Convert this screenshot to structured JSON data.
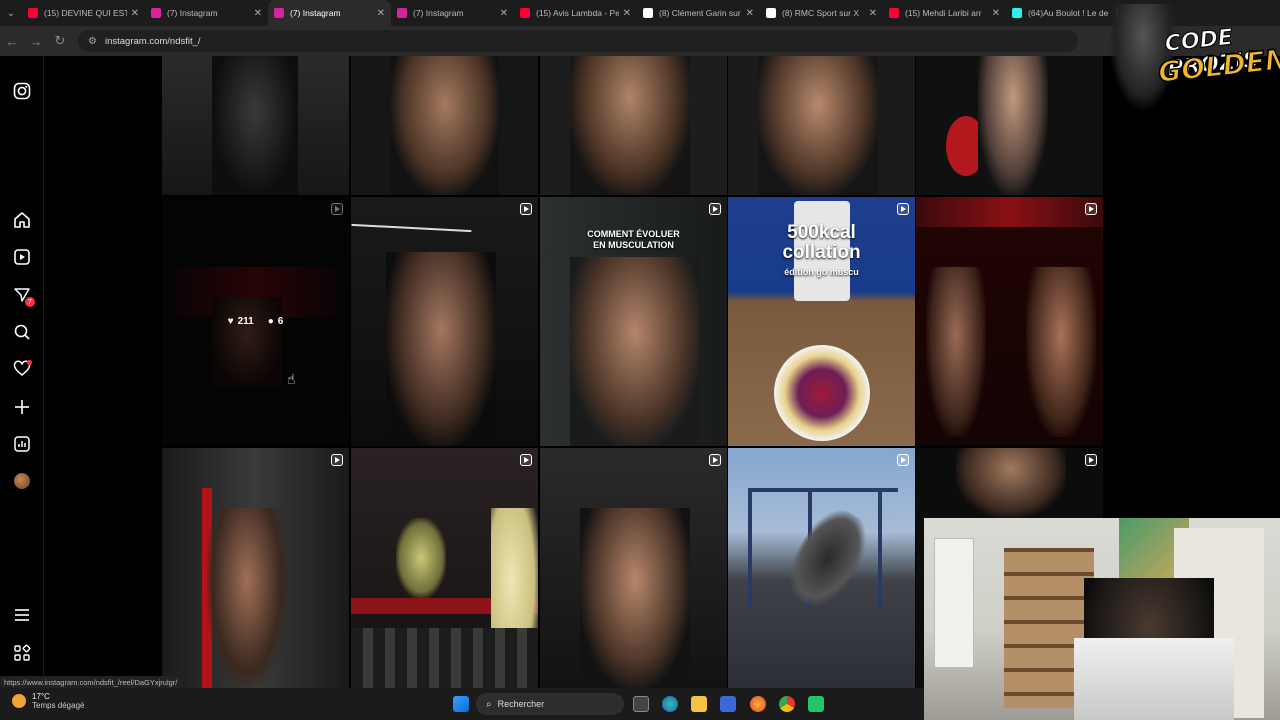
{
  "tabs": [
    {
      "title": "(15) DEVINE QUI EST",
      "icon": "youtube-icon",
      "color": "#ff0033",
      "active": false
    },
    {
      "title": "(7) Instagram",
      "icon": "instagram-icon",
      "color": "#d6249f",
      "active": false
    },
    {
      "title": "(7) Instagram",
      "icon": "instagram-icon",
      "color": "#d6249f",
      "active": true
    },
    {
      "title": "(7) Instagram",
      "icon": "instagram-icon",
      "color": "#d6249f",
      "active": false
    },
    {
      "title": "(15) Avis Lambda - Pe",
      "icon": "youtube-icon",
      "color": "#ff0033",
      "active": false
    },
    {
      "title": "(8) Clément Garin sur",
      "icon": "x-icon",
      "color": "#ffffff",
      "active": false
    },
    {
      "title": "(8) RMC Sport sur X",
      "icon": "x-icon",
      "color": "#ffffff",
      "active": false
    },
    {
      "title": "(15) Mehdi Laribi arr",
      "icon": "youtube-icon",
      "color": "#ff0033",
      "active": false
    },
    {
      "title": "(64)Au Boulot ! Le de",
      "icon": "tiktok-icon",
      "color": "#25f4ee",
      "active": false
    }
  ],
  "address": {
    "url": "instagram.com/ndsfit_/"
  },
  "sidebar": {
    "notifications_badge": "7"
  },
  "grid": {
    "hover_post": {
      "likes": "211",
      "comments": "6"
    },
    "captions": {
      "evolve": "COMMENT ÉVOLUER EN MUSCULATION",
      "kcal_line1": "500kcal",
      "kcal_line2": "collation",
      "kcal_line3": "édition go muscu"
    }
  },
  "status_link": "https://www.instagram.com/ndsfit_/reel/DaGYxjrulgr/",
  "taskbar": {
    "temperature": "17°C",
    "weather": "Temps dégagé",
    "search_label": "Rechercher"
  },
  "stream_overlay": {
    "line1": "CODE PROZIS",
    "line2": "GOLDENG"
  }
}
